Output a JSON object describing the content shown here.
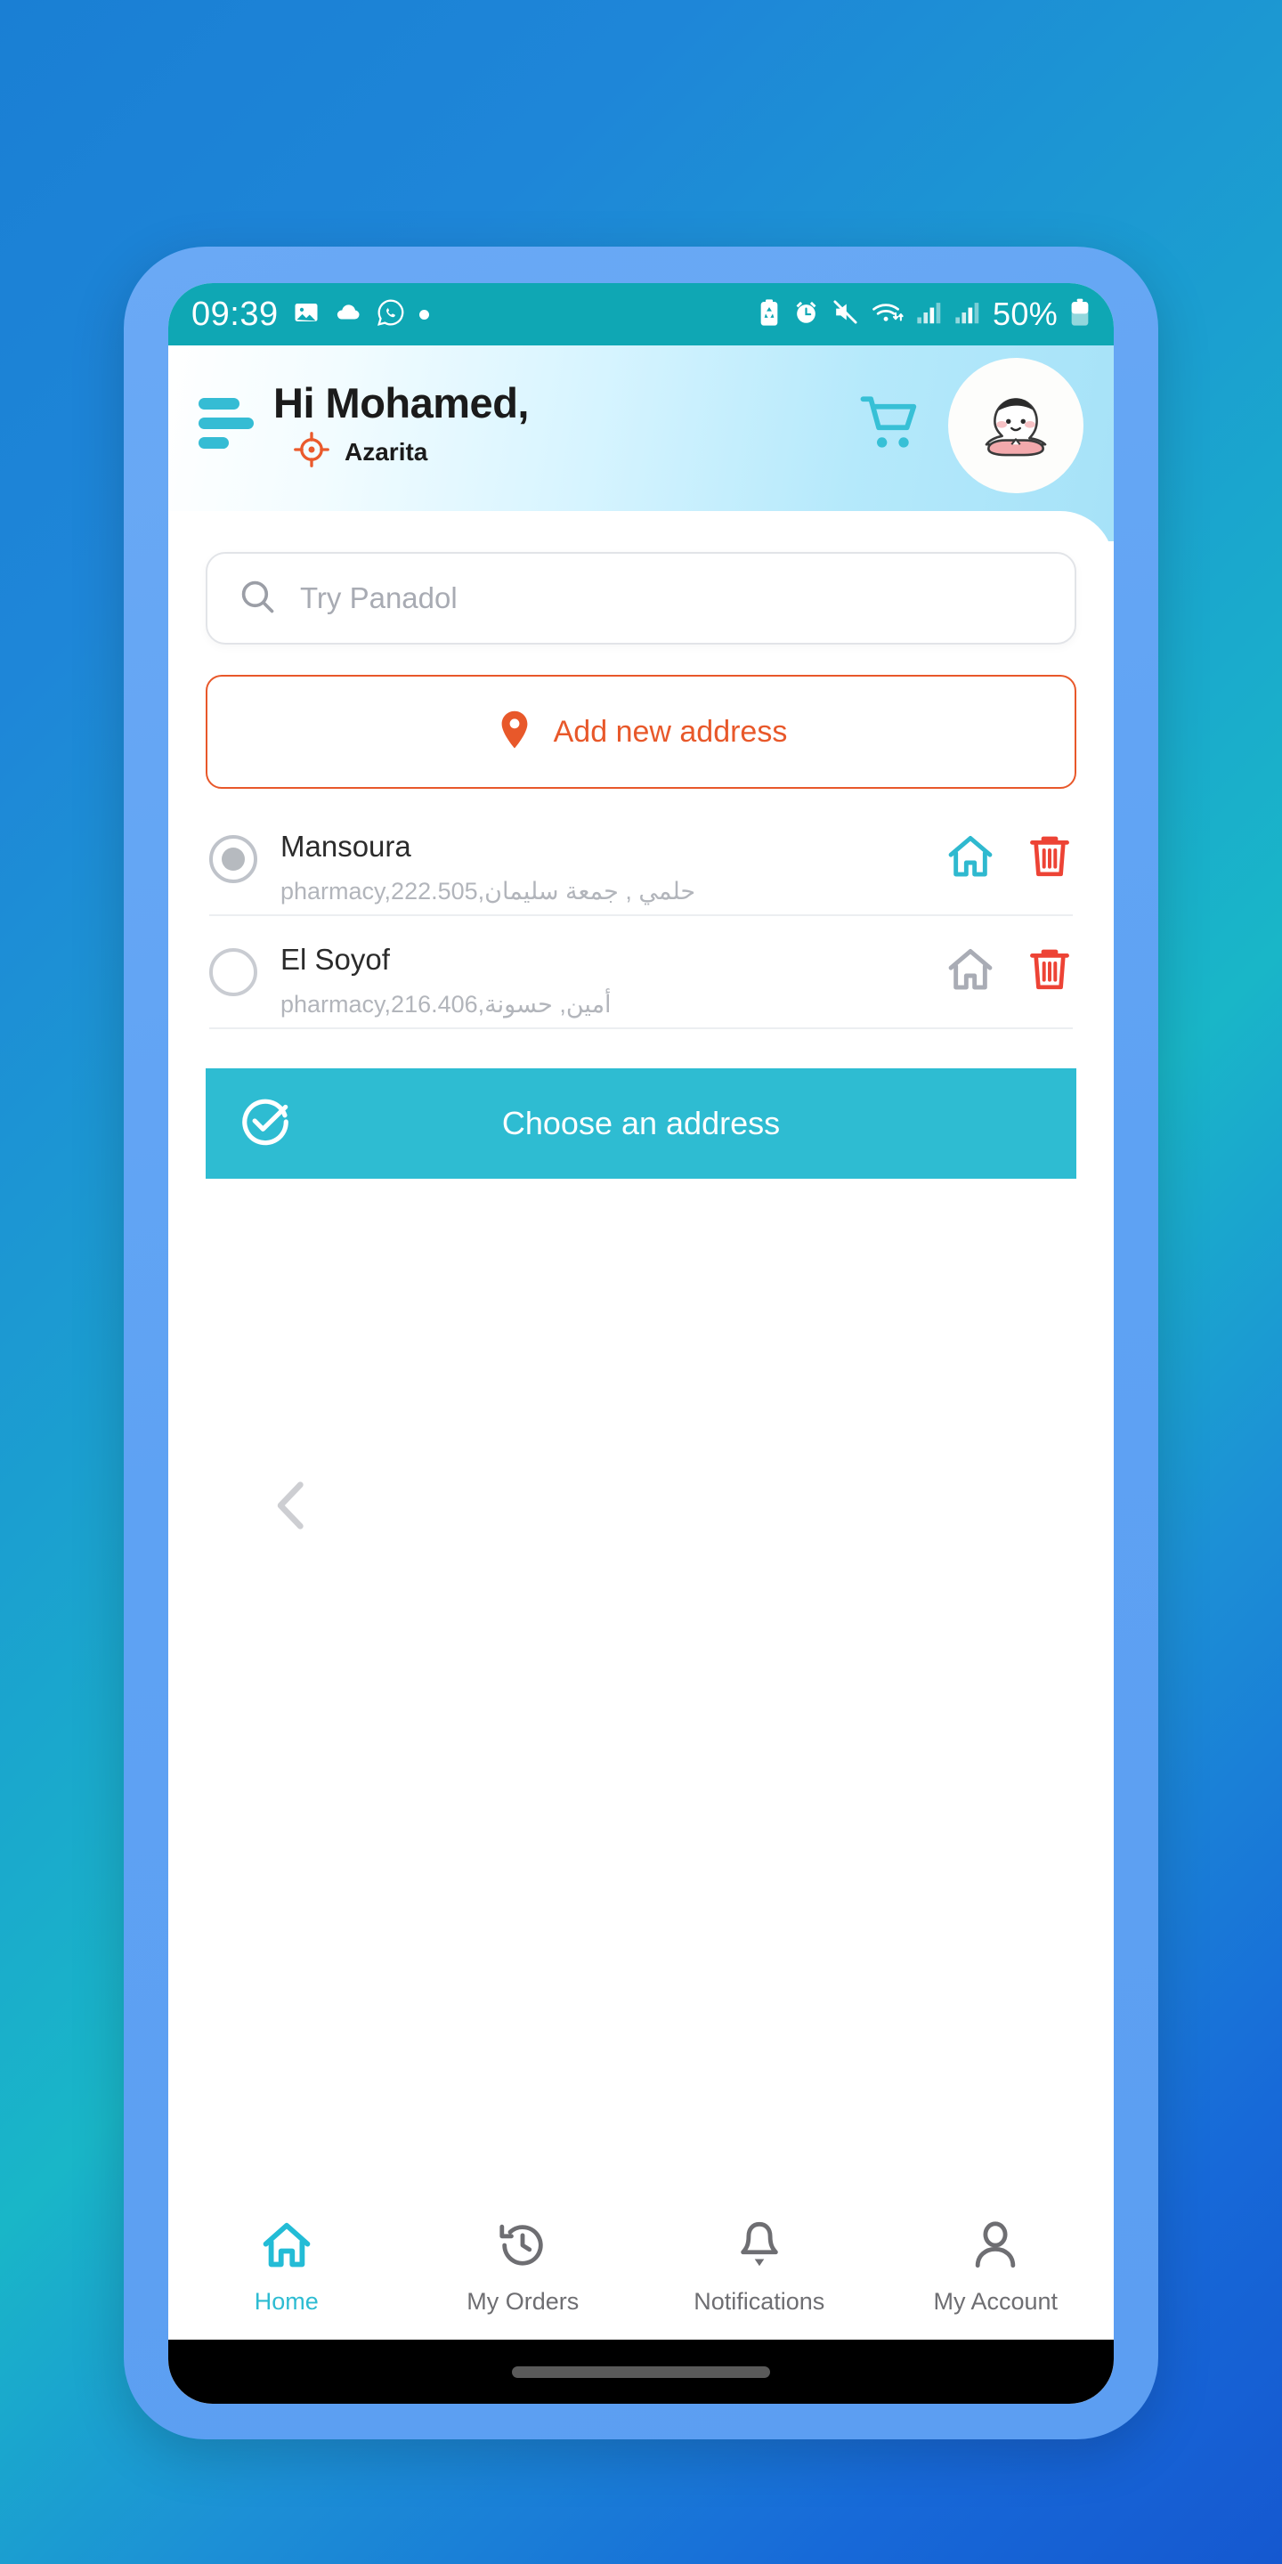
{
  "status_bar": {
    "time": "09:39",
    "battery_percent": "50%",
    "left_icons": [
      "image-icon",
      "cloud-icon",
      "whatsapp-icon",
      "dot-icon"
    ],
    "right_icons": [
      "battery-saver-icon",
      "alarm-icon",
      "mute-icon",
      "wifi-icon",
      "signal-one-icon",
      "signal-two-icon"
    ],
    "background_color": "#0fa7b4"
  },
  "header": {
    "menu_icon": "hamburger-icon",
    "greeting": "Hi Mohamed,",
    "location_icon": "crosshair-location-icon",
    "location": "Azarita",
    "cart_icon": "shopping-cart-icon",
    "avatar_icon": "user-avatar-character",
    "accent_color": "#35bcd4"
  },
  "search": {
    "icon": "search-icon",
    "placeholder": "Try Panadol",
    "value": ""
  },
  "add_address": {
    "icon": "map-pin-icon",
    "label": "Add new address",
    "color": "#e8582a"
  },
  "addresses": [
    {
      "title": "Mansoura",
      "subtitle": "pharmacy,حلمي , جمعة سليمان,222.505",
      "selected": true,
      "home_icon": "home-icon",
      "home_icon_active": true,
      "delete_icon": "trash-icon"
    },
    {
      "title": "El Soyof",
      "subtitle": "pharmacy,أمين, حسونة,216.406",
      "selected": false,
      "home_icon": "home-icon",
      "home_icon_active": false,
      "delete_icon": "trash-icon"
    }
  ],
  "choose_button": {
    "icon": "check-circle-icon",
    "label": "Choose an address",
    "color": "#2ebcd2"
  },
  "back_chevron": {
    "icon": "chevron-left-icon"
  },
  "bottom_nav": {
    "active_color": "#2ebcd2",
    "items": [
      {
        "label": "Home",
        "icon": "home-icon",
        "active": true
      },
      {
        "label": "My Orders",
        "icon": "history-clock-icon",
        "active": false
      },
      {
        "label": "Notifications",
        "icon": "bell-icon",
        "active": false
      },
      {
        "label": "My Account",
        "icon": "person-icon",
        "active": false
      }
    ]
  }
}
